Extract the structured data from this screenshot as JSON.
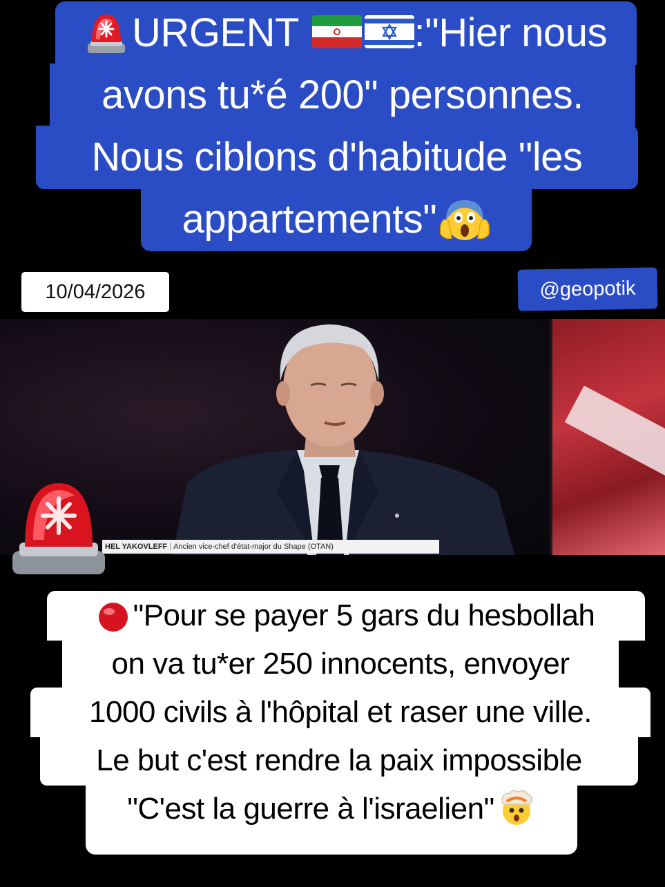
{
  "headline": {
    "line1": "URGENT",
    "line1_rest": ":\"Hier nous",
    "line2": "avons tu*é 200\" personnes.",
    "line3": "Nous ciblons d'habitude \"les",
    "line4": "appartements\"",
    "icons": [
      "police-siren-icon",
      "iran-flag-icon",
      "israel-flag-icon",
      "face-screaming-icon"
    ]
  },
  "date": "10/04/2026",
  "handle": "@geopotik",
  "video": {
    "lower_third_name": "HEL YAKOVLEFF",
    "lower_third_title": "Ancien vice-chef d'état-major du Shape (OTAN)"
  },
  "quote": {
    "line1": "\"Pour se payer 5 gars du hesbollah",
    "line2": "on va tu*er 250 innocents, envoyer",
    "line3": "1000 civils à l'hôpital et raser une ville.",
    "line4": "Le but c'est rendre la paix impossible",
    "line5": "\"C'est la guerre à l'israelien\"",
    "icons": [
      "red-circle-icon",
      "exploding-head-icon"
    ]
  },
  "colors": {
    "headline_bg": "#2a4cc4",
    "quote_bg": "#ffffff",
    "page_bg": "#000000"
  }
}
